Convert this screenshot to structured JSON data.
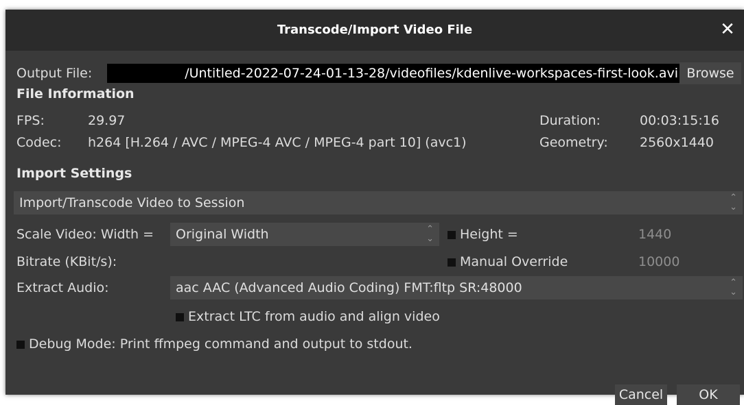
{
  "window": {
    "title": "Transcode/Import Video File",
    "close_glyph": "✕"
  },
  "output": {
    "label": "Output File:",
    "path": "/Untitled-2022-07-24-01-13-28/videofiles/kdenlive-workspaces-first-look.avi",
    "browse_label": "Browse"
  },
  "file_info": {
    "heading": "File Information",
    "fps_label": "FPS:",
    "fps_value": "29.97",
    "codec_label": "Codec:",
    "codec_value": "h264 [H.264 / AVC / MPEG-4 AVC / MPEG-4 part 10] (avc1)",
    "duration_label": "Duration:",
    "duration_value": "00:03:15:16",
    "geometry_label": "Geometry:",
    "geometry_value": "2560x1440"
  },
  "import_settings": {
    "heading": "Import Settings",
    "mode_selected": "Import/Transcode Video to Session",
    "scale_label": "Scale Video: Width =",
    "width_selected": "Original Width",
    "height_label": "Height =",
    "height_value": "1440",
    "bitrate_label": "Bitrate (KBit/s):",
    "manual_override_label": "Manual Override",
    "bitrate_value": "10000",
    "extract_audio_label": "Extract Audio:",
    "audio_selected": "aac AAC (Advanced Audio Coding) FMT:fltp SR:48000",
    "ltc_label": "Extract LTC from audio and align video",
    "debug_label": "Debug Mode: Print ffmpeg command and output to stdout."
  },
  "buttons": {
    "cancel": "Cancel",
    "ok": "OK"
  },
  "colors": {
    "dialog_bg": "#3a3a3a",
    "titlebar_bg": "#2b2b2b",
    "path_bg": "#000000"
  }
}
